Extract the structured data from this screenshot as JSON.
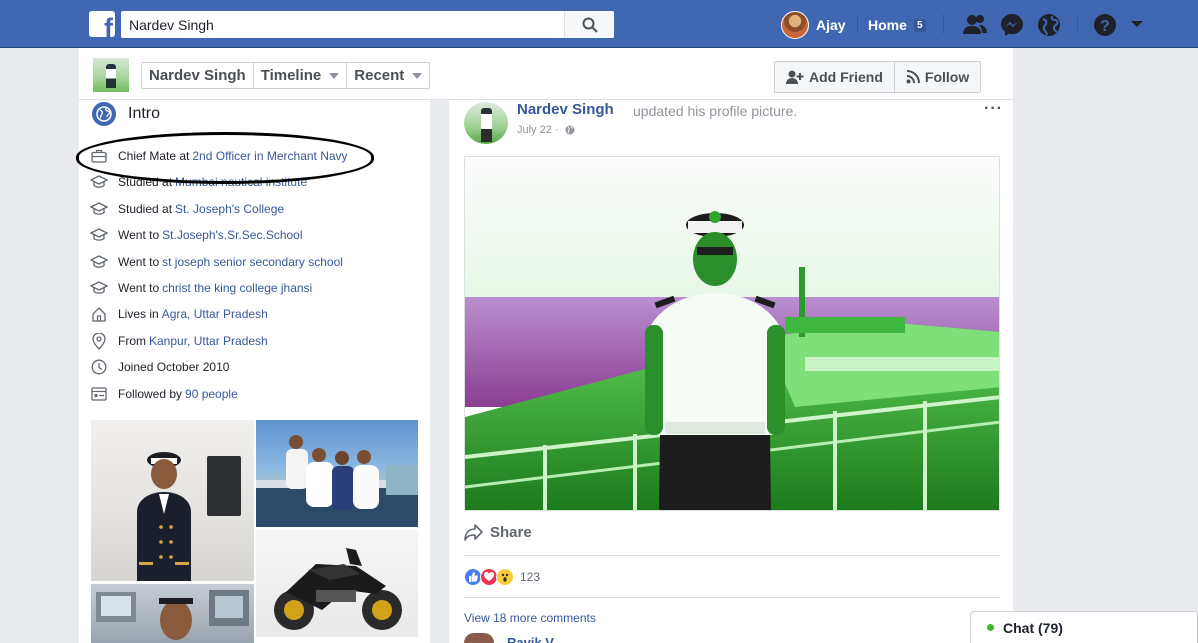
{
  "topbar": {
    "logo_letter": "f",
    "search_value": "Nardev Singh",
    "user_name": "Ajay",
    "home_label": "Home",
    "home_badge": "5",
    "icons": [
      "friend-requests-icon",
      "messenger-icon",
      "notifications-globe-icon",
      "help-icon",
      "account-menu-chevron-icon"
    ],
    "colors": {
      "bar": "#4267b2",
      "link": "#365899"
    }
  },
  "profile_nav": {
    "name_tab": "Nardev Singh",
    "timeline_tab": "Timeline",
    "recent_tab": "Recent",
    "add_friend": "Add Friend",
    "follow": "Follow"
  },
  "intro": {
    "title": "Intro",
    "items": [
      {
        "icon": "briefcase-icon",
        "prefix": "Chief Mate at",
        "link": "2nd Officer in Merchant Navy"
      },
      {
        "icon": "graduation-cap-icon",
        "prefix": "Studied at",
        "link": "Mumbai nautical institute"
      },
      {
        "icon": "graduation-cap-icon",
        "prefix": "Studied at",
        "link": "St. Joseph's College"
      },
      {
        "icon": "graduation-cap-icon",
        "prefix": "Went to",
        "link": "St.Joseph's.Sr.Sec.School"
      },
      {
        "icon": "graduation-cap-icon",
        "prefix": "Went to",
        "link": "st joseph senior secondary school"
      },
      {
        "icon": "graduation-cap-icon",
        "prefix": "Went to",
        "link": "christ the king college jhansi"
      },
      {
        "icon": "house-icon",
        "prefix": "Lives in",
        "link": "Agra, Uttar Pradesh"
      },
      {
        "icon": "location-pin-icon",
        "prefix": "From",
        "link": "Kanpur, Uttar Pradesh"
      },
      {
        "icon": "clock-icon",
        "prefix": "Joined October 2010",
        "link": ""
      },
      {
        "icon": "followers-icon",
        "prefix": "Followed by",
        "link": "90 people"
      }
    ]
  },
  "post": {
    "author": "Nardev Singh",
    "action": "updated his profile picture.",
    "date": "July 22",
    "date_separator": "·",
    "more": "···",
    "share_label": "Share",
    "reaction_count": "123",
    "reactions": [
      "like-icon",
      "love-icon",
      "wow-icon"
    ],
    "view_comments": "View 18 more comments",
    "first_comment_author": "Ravik V..."
  },
  "chat": {
    "label": "Chat (79)",
    "status_color": "#42b72a"
  }
}
